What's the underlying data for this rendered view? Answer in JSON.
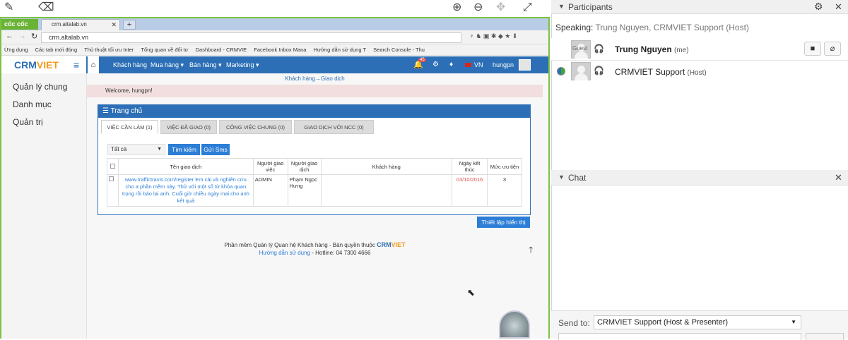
{
  "top_toolbar": {
    "icons": [
      "pencil-icon",
      "eraser-icon",
      "zoom-in-icon",
      "zoom-out-icon",
      "move-icon",
      "fullscreen-icon"
    ]
  },
  "browser": {
    "brand": "cốc cốc",
    "tab_title": "crm.altalab.vn",
    "url": "crm.altalab.vn",
    "bookmarks": [
      "Ứng dụng",
      "Các tab mới đóng",
      "Thủ thuật tối ưu Inter",
      "Tổng quan về đối tư",
      "Dashboard - CRMVIE",
      "Facebook Inbox Mana",
      "Hướng dẫn sử dụng T",
      "Search Console - Thu"
    ]
  },
  "crm": {
    "logo_prefix": "CRM",
    "logo_suffix": "VIET",
    "nav": [
      "Khách hàng",
      "Mua hàng ▾",
      "Bán hàng ▾",
      "Marketing ▾"
    ],
    "notif_count": "45",
    "lang": "VN",
    "user": "hungpn",
    "sidebar": [
      "Quản lý chung",
      "Danh mục",
      "Quản trị"
    ],
    "breadcrumb": "Khách hàng→Giao dịch",
    "welcome": "Welcome, hungpn!",
    "panel_title": "Trang chủ",
    "tabs": [
      "VIỆC CẦN LÀM (1)",
      "VIỆC ĐÃ GIAO (0)",
      "CÔNG VIỆC CHUNG (0)",
      "GIAO DỊCH VỚI NCC (0)"
    ],
    "filter_value": "Tất cả",
    "search_btn": "Tìm kiếm",
    "sms_btn": "Gửi Sms",
    "table": {
      "headers": [
        "Tên giao dịch",
        "Người giao việc",
        "Người giao dịch",
        "Khách hàng",
        "Ngày kết thúc",
        "Mức ưu tiên"
      ],
      "rows": [
        {
          "name": "www.traffictravis.com/register Em cài và nghiên cứu cho a phần mềm này. Thử với một số từ khóa quan trọng rồi báo lại anh. Cuối giờ chiều ngày mai cho anh kết quả",
          "assigner": "ADMIN",
          "contact": "Phạm Ngọc Hưng",
          "customer": "",
          "end_date": "03/10/2016",
          "priority": "3"
        }
      ]
    },
    "settings_btn": "Thiết lập hiển thị",
    "footer_text": "Phần mềm Quản lý Quan hệ Khách hàng - Bản quyền thuộc",
    "footer_link": "Hướng dẫn sử dụng",
    "footer_hotline": "- Hotline: 04 7300 4666"
  },
  "participants_panel": {
    "title": "Participants",
    "speaking_label": "Speaking:",
    "speaking_names": "Trung Nguyen, CRMVIET Support (Host)",
    "people": [
      {
        "avatar_label": "Guest",
        "name": "Trung Nguyen",
        "role": "(me)"
      },
      {
        "avatar_label": "",
        "name": "CRMVIET Support",
        "role": "(Host)"
      }
    ]
  },
  "chat_panel": {
    "title": "Chat",
    "send_to_label": "Send to:",
    "send_to_value": "CRMVIET Support (Host & Presenter)"
  }
}
